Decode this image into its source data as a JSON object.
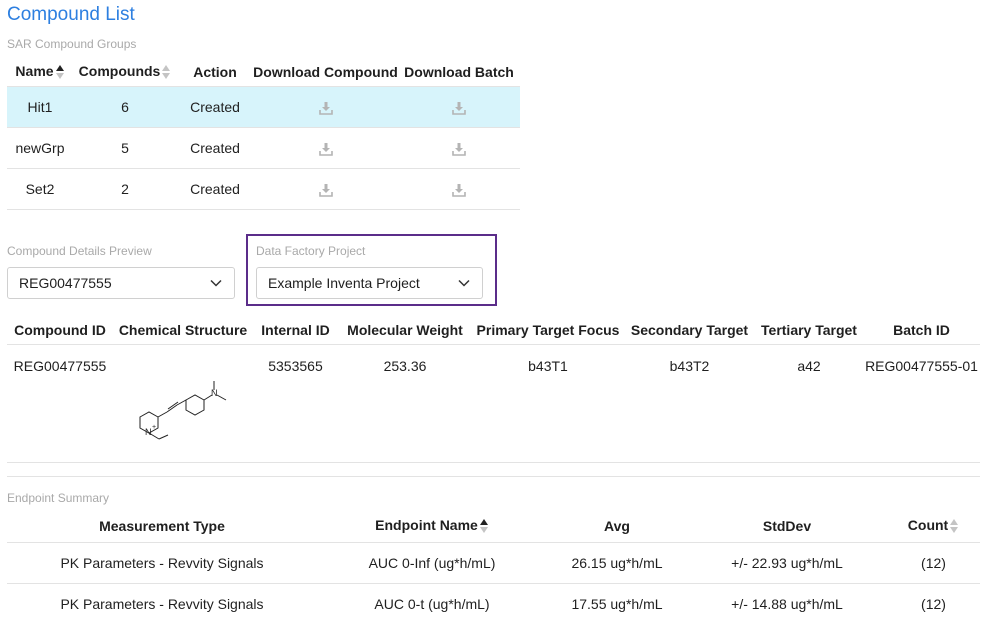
{
  "page": {
    "title": "Compound List"
  },
  "groups_section": {
    "label": "SAR Compound Groups",
    "columns": {
      "name": "Name",
      "compounds": "Compounds",
      "action": "Action",
      "download_compound": "Download Compound",
      "download_batch": "Download Batch"
    },
    "rows": [
      {
        "name": "Hit1",
        "compounds": "6",
        "action": "Created"
      },
      {
        "name": "newGrp",
        "compounds": "5",
        "action": "Created"
      },
      {
        "name": "Set2",
        "compounds": "2",
        "action": "Created"
      }
    ]
  },
  "details_preview": {
    "label": "Compound Details Preview",
    "selected": "REG00477555"
  },
  "data_factory": {
    "label": "Data Factory Project",
    "selected": "Example Inventa Project"
  },
  "details_table": {
    "columns": [
      "Compound ID",
      "Chemical Structure",
      "Internal ID",
      "Molecular Weight",
      "Primary Target Focus",
      "Secondary Target",
      "Tertiary Target",
      "Batch ID"
    ],
    "row": {
      "compound_id": "REG00477555",
      "internal_id": "5353565",
      "molecular_weight": "253.36",
      "primary_target": "b43T1",
      "secondary_target": "b43T2",
      "tertiary_target": "a42",
      "batch_id": "REG00477555-01",
      "structure_atom_label": "N",
      "structure_charge": "+"
    }
  },
  "endpoint_section": {
    "label": "Endpoint Summary",
    "columns": {
      "measurement_type": "Measurement Type",
      "endpoint_name": "Endpoint Name",
      "avg": "Avg",
      "stddev": "StdDev",
      "count": "Count"
    },
    "rows": [
      {
        "measurement_type": "PK Parameters - Revvity Signals",
        "endpoint_name": "AUC 0-Inf (ug*h/mL)",
        "avg": "26.15 ug*h/mL",
        "stddev": "+/- 22.93 ug*h/mL",
        "count": "(12)"
      },
      {
        "measurement_type": "PK Parameters - Revvity Signals",
        "endpoint_name": "AUC 0-t (ug*h/mL)",
        "avg": "17.55 ug*h/mL",
        "stddev": "+/- 14.88 ug*h/mL",
        "count": "(12)"
      }
    ]
  },
  "icons": {
    "download": "download-icon",
    "chevron": "chevron-down-icon"
  },
  "colors": {
    "title": "#2d7fe0",
    "selected_row": "#d7f4fb",
    "highlight_border": "#5b2d8a"
  }
}
